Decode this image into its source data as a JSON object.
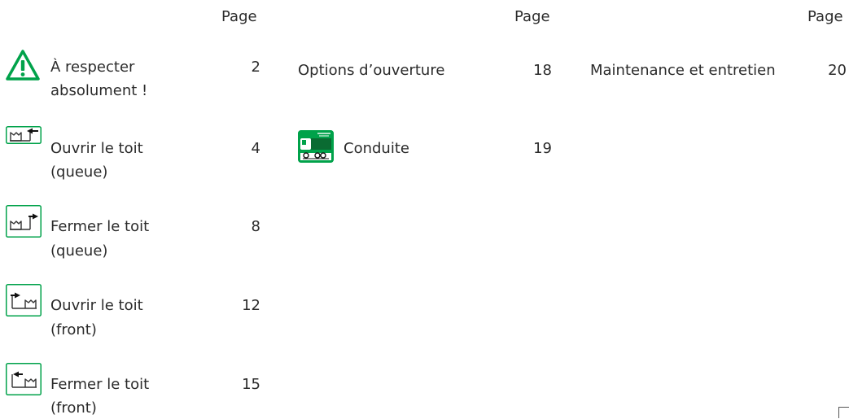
{
  "columns": [
    {
      "page_header": "Page"
    },
    {
      "page_header": "Page"
    },
    {
      "page_header": "Page"
    }
  ],
  "entries": {
    "respect": {
      "icon": "warning-triangle-icon",
      "line1": "À respecter",
      "line2": "absolument !",
      "page": "2"
    },
    "open_rear": {
      "icon": "open-roof-rear-icon",
      "line1": "Ouvrir le toit",
      "line2": "(queue)",
      "page": "4"
    },
    "close_rear": {
      "icon": "close-roof-rear-icon",
      "line1": "Fermer le toit",
      "line2": "(queue)",
      "page": "8"
    },
    "open_front": {
      "icon": "open-roof-front-icon",
      "line1": "Ouvrir le toit",
      "line2": "(front)",
      "page": "12"
    },
    "close_front": {
      "icon": "close-roof-front-icon",
      "line1": "Fermer le toit",
      "line2": "(front)",
      "page": "15"
    },
    "options": {
      "line1": "Options d’ouverture",
      "page": "18"
    },
    "driving": {
      "icon": "truck-driving-icon",
      "line1": "Conduite",
      "page": "19"
    },
    "maintenance": {
      "line1": "Maintenance et entretien",
      "page": "20"
    }
  },
  "colors": {
    "accent": "#00a24a",
    "text": "#2b2b2b"
  }
}
